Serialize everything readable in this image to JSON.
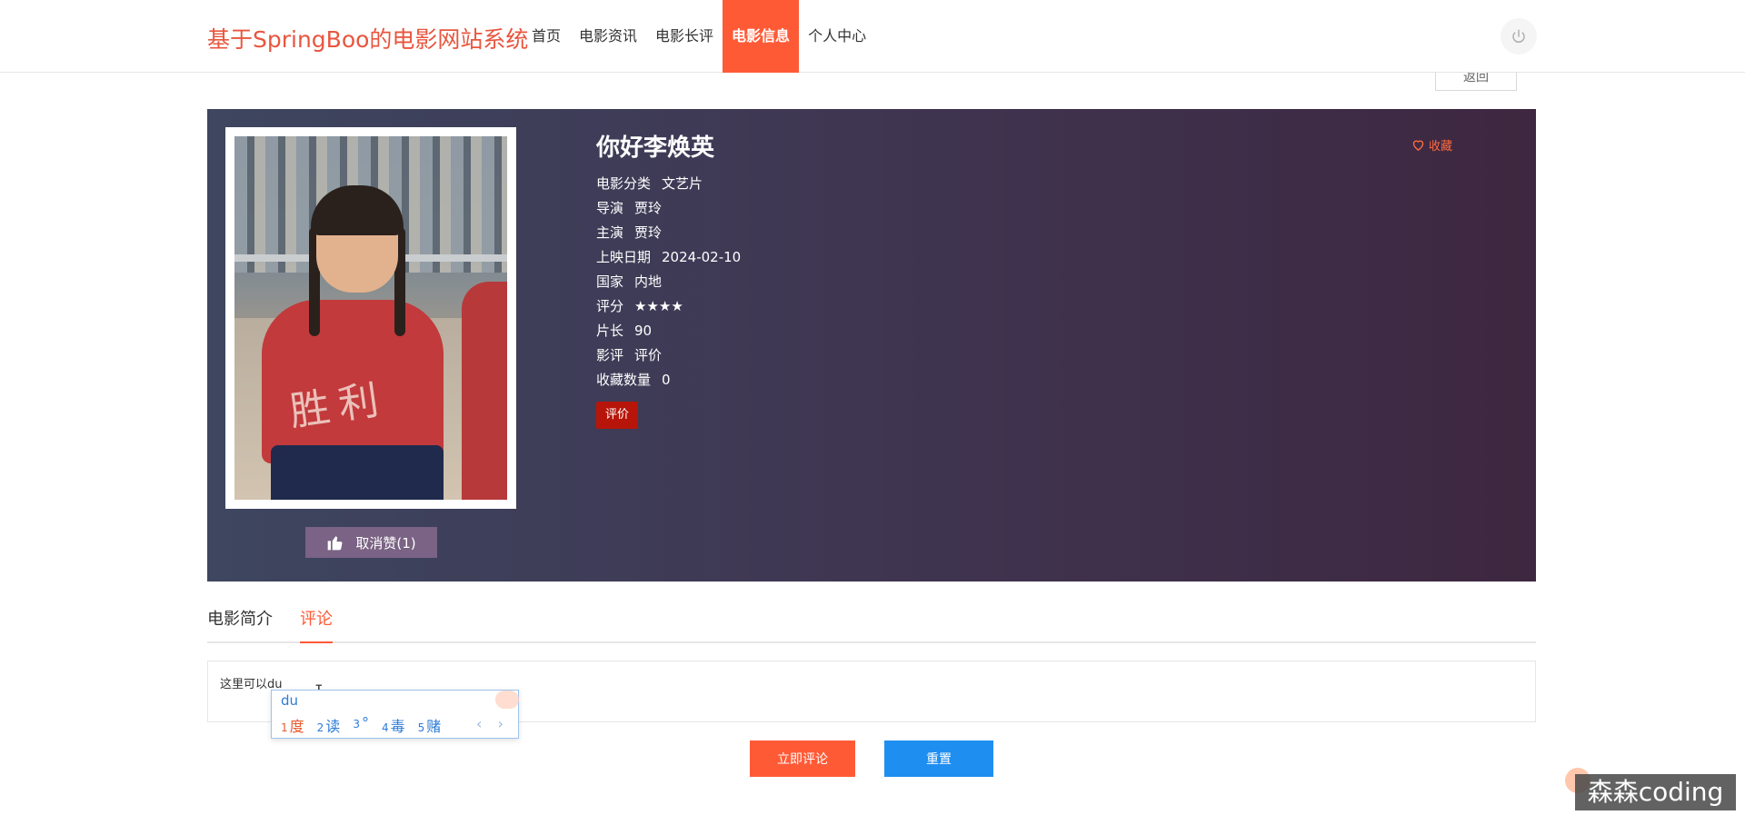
{
  "header": {
    "brand": "基于SpringBoo的电影网站系统",
    "nav": [
      {
        "label": "首页"
      },
      {
        "label": "电影资讯"
      },
      {
        "label": "电影长评"
      },
      {
        "label": "电影信息",
        "active": true
      },
      {
        "label": "个人中心"
      }
    ]
  },
  "back_label": "返回",
  "movie": {
    "title": "你好李焕英",
    "favorite_label": "收藏",
    "like_label": "取消赞(1)",
    "rate_button": "评价",
    "fields": [
      {
        "label": "电影分类",
        "value": "文艺片"
      },
      {
        "label": "导演",
        "value": "贾玲"
      },
      {
        "label": "主演",
        "value": "贾玲"
      },
      {
        "label": "上映日期",
        "value": "2024-02-10"
      },
      {
        "label": "国家",
        "value": "内地"
      },
      {
        "label": "评分",
        "value": "★★★★"
      },
      {
        "label": "片长",
        "value": "90"
      },
      {
        "label": "影评",
        "value": "评价"
      },
      {
        "label": "收藏数量",
        "value": "0"
      }
    ],
    "poster_text": "胜利"
  },
  "tabs": [
    {
      "label": "电影简介"
    },
    {
      "label": "评论",
      "active": true
    }
  ],
  "comment": {
    "text": "这里可以du",
    "submit_label": "立即评论",
    "reset_label": "重置"
  },
  "ime": {
    "input": "du",
    "candidates": [
      {
        "num": "1",
        "text": "度"
      },
      {
        "num": "2",
        "text": "读"
      },
      {
        "num": "3",
        "text": "°"
      },
      {
        "num": "4",
        "text": "毒"
      },
      {
        "num": "5",
        "text": "赌"
      }
    ],
    "arrows": "‹ ›"
  },
  "watermark": "森森coding",
  "colors": {
    "accent": "#ff5a36",
    "brand": "#e8563f",
    "rate_button": "#b7150a",
    "reset_button": "#1f8ef1",
    "hero_from": "#3e4660",
    "hero_to": "#3e2740"
  }
}
